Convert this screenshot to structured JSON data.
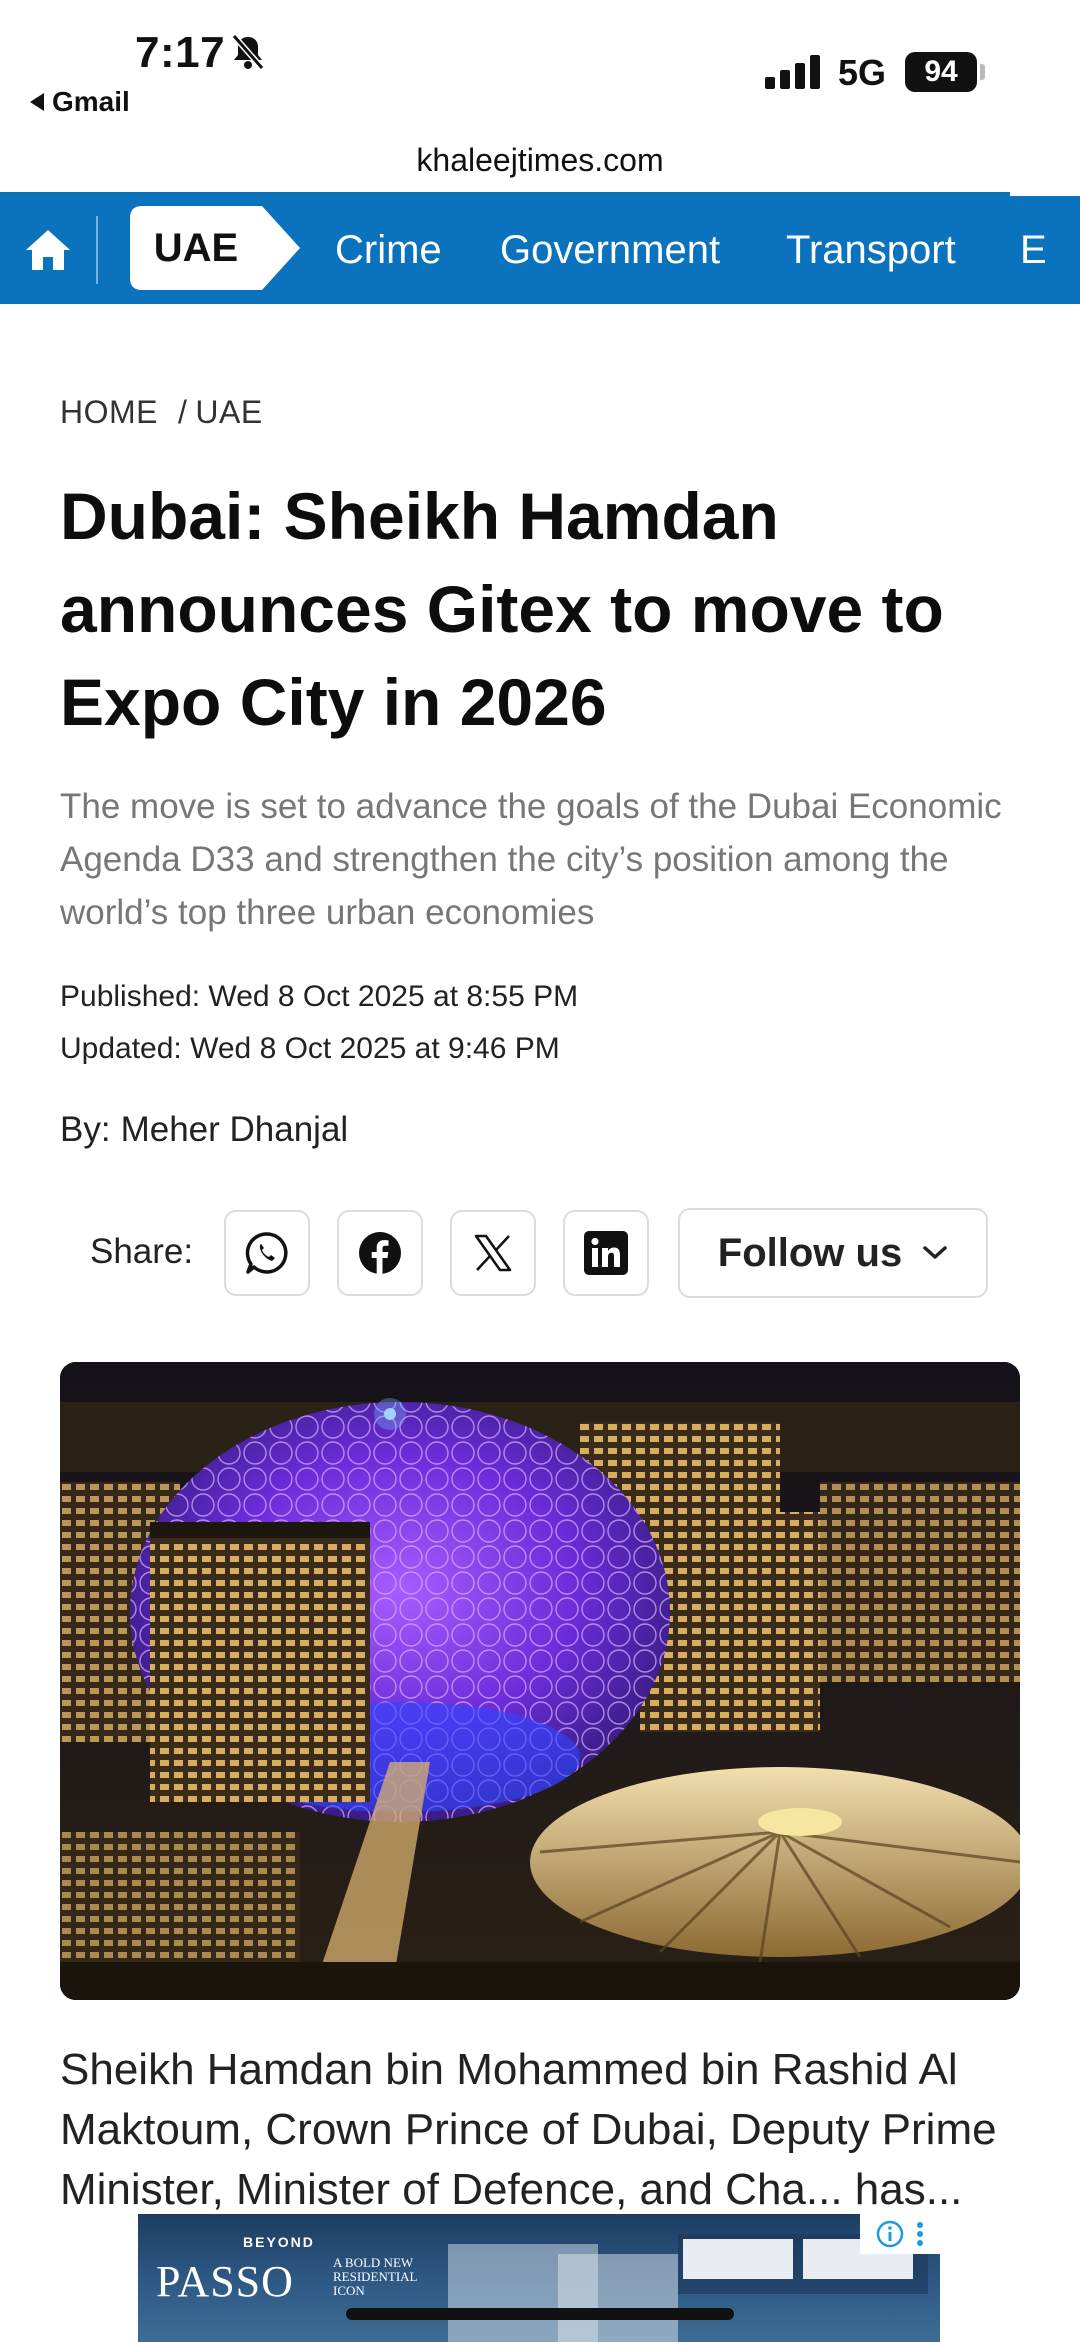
{
  "status_bar": {
    "time": "7:17",
    "back_app": "Gmail",
    "network": "5G",
    "battery": "94"
  },
  "browser": {
    "url": "khaleejtimes.com"
  },
  "nav": {
    "active": "UAE",
    "items": [
      "Crime",
      "Government",
      "Transport",
      "E"
    ]
  },
  "breadcrumb": {
    "home": "HOME",
    "separator": "/",
    "current": "UAE"
  },
  "article": {
    "headline": "Dubai: Sheikh Hamdan announces Gitex to move to Expo City in 2026",
    "subheadline": "The move is set to advance the goals of the Dubai Economic Agenda D33 and strengthen the city’s position among the world’s top three urban economies",
    "published": "Published: Wed 8 Oct 2025 at 8:55 PM",
    "updated": "Updated: Wed 8 Oct 2025 at 9:46 PM",
    "by_label": "By:",
    "author": "Meher Dhanjal",
    "body_visible": "Sheikh Hamdan bin Mohammed bin Rashid Al Maktoum, Crown Prince of Dubai, Deputy Prime Minister, Minister of Defence, and Cha... has..."
  },
  "share": {
    "label": "Share:",
    "follow_label": "Follow us"
  },
  "ad": {
    "brand": "PASSO",
    "eyebrow": "BEYOND",
    "tagline": "A BOLD NEW RESIDENTIAL ICON"
  },
  "colors": {
    "nav_blue": "#0b72bd",
    "text_dark": "#0d0d0d",
    "subtext": "#777777"
  }
}
